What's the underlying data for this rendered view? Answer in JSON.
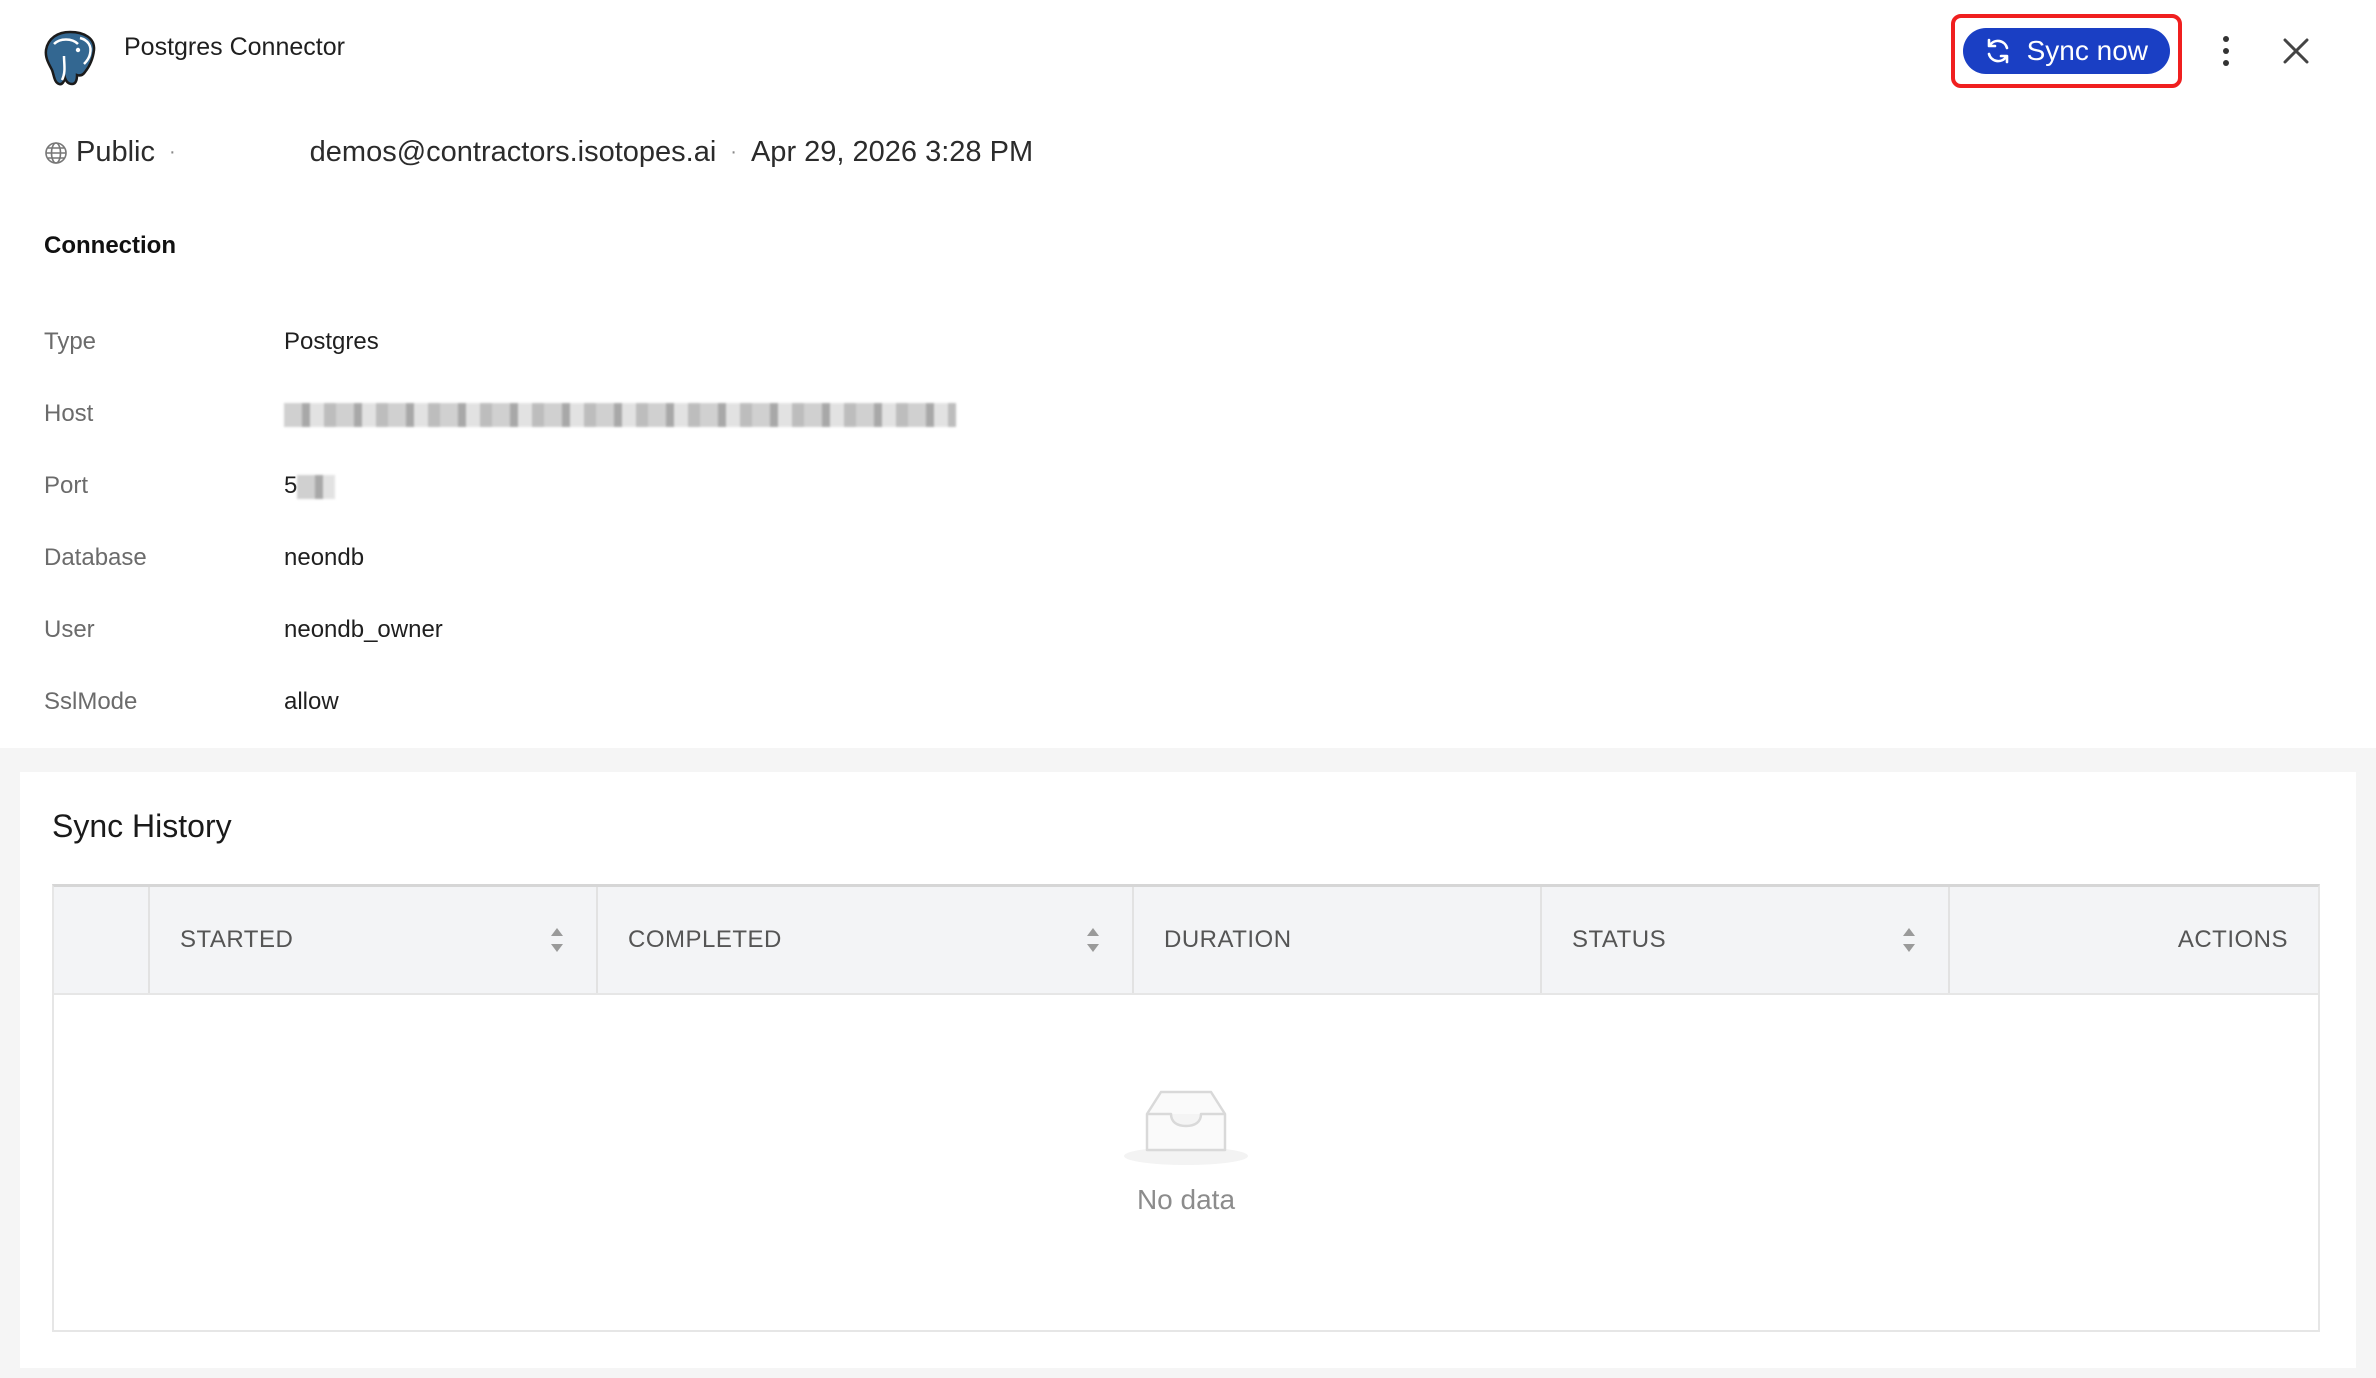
{
  "header": {
    "title": "Postgres Connector",
    "logo_icon": "postgres-elephant-icon",
    "sync_label": "Sync now",
    "accent_color": "#1a3fc4",
    "highlight_color": "#f01f1f"
  },
  "meta": {
    "visibility": "Public",
    "owner": "demos@contractors.isotopes.ai",
    "date": "Apr 29, 2026 3:28 PM"
  },
  "connection": {
    "section_title": "Connection",
    "rows": [
      {
        "label": "Type",
        "value": "Postgres"
      },
      {
        "label": "Host",
        "value": ""
      },
      {
        "label": "Port",
        "value": "5"
      },
      {
        "label": "Database",
        "value": "neondb"
      },
      {
        "label": "User",
        "value": "neondb_owner"
      },
      {
        "label": "SslMode",
        "value": "allow"
      }
    ]
  },
  "sync_history": {
    "title": "Sync History",
    "columns": [
      "",
      "STARTED",
      "COMPLETED",
      "DURATION",
      "STATUS",
      "ACTIONS"
    ],
    "empty_text": "No data"
  }
}
